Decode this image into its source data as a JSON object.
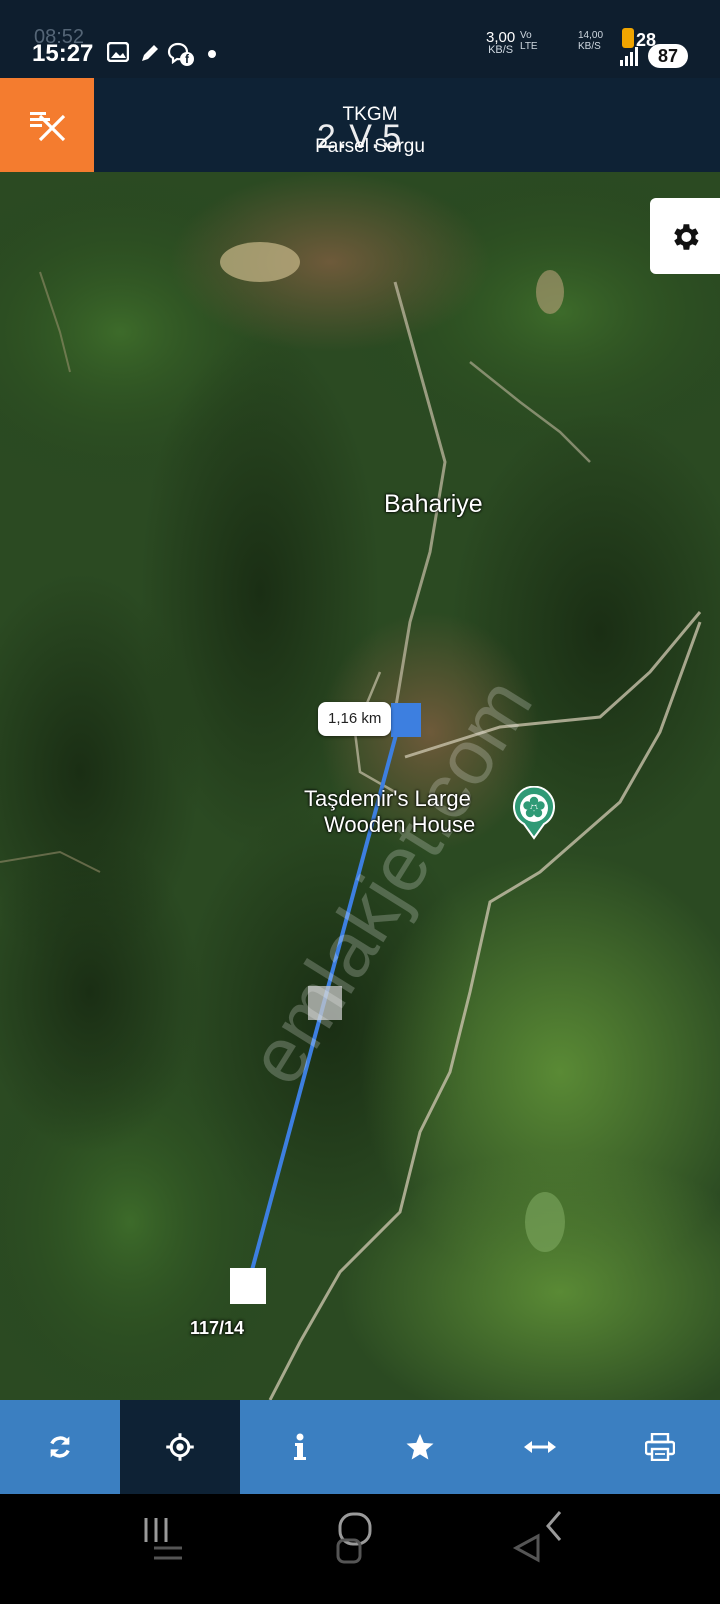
{
  "status_bar": {
    "time": "15:27",
    "ghost_time": "08:52",
    "network_speed_line1": "3,00",
    "network_speed_line2": "KB/S",
    "volte_line1": "Vo",
    "volte_line2": "LTE",
    "speed2_line1": "14,00",
    "speed2_line2": "KB/S",
    "notification_count": "28",
    "battery": "87",
    "icons": [
      "image-icon",
      "edit-icon",
      "messenger-icon",
      "facebook-icon"
    ]
  },
  "header": {
    "title": "TKGM",
    "version": "2.V.5",
    "subtitle": "Parsel Sorgu",
    "menu_icon": "menu-close-icon",
    "accent_color": "#f47c2f"
  },
  "map": {
    "place_name": "Bahariye",
    "poi_name_line1": "Taşdemir's Large",
    "poi_name_line2": "Wooden House",
    "poi_icon": "flower-icon",
    "distance_label": "1,16 km",
    "parcel_label": "117/14",
    "watermark": "emlakjet.com",
    "settings_icon": "gear-icon",
    "measure_line_color": "#3d7fe0"
  },
  "toolbar": {
    "items": [
      {
        "icon": "refresh-icon",
        "active": false
      },
      {
        "icon": "crosshair-icon",
        "active": true
      },
      {
        "icon": "info-icon",
        "active": false
      },
      {
        "icon": "star-icon",
        "active": false
      },
      {
        "icon": "measure-icon",
        "active": false
      },
      {
        "icon": "print-icon",
        "active": false
      }
    ],
    "bar_color": "#3b7fc1"
  },
  "nav_bar": {
    "items": [
      "recent-apps-icon",
      "home-icon",
      "back-icon"
    ]
  }
}
